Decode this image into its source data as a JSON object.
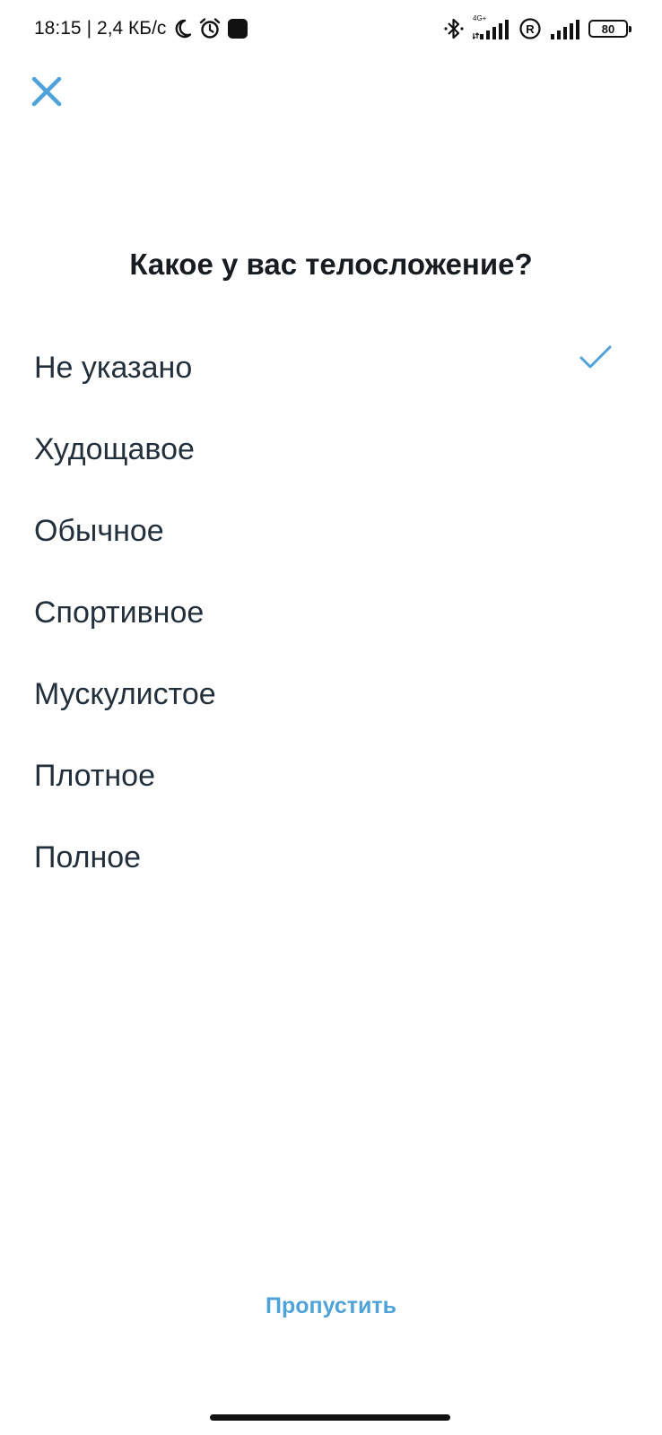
{
  "status_bar": {
    "time": "18:15",
    "separator": "|",
    "network_speed": "2,4 КБ/с",
    "network_type": "4G+",
    "battery": "80"
  },
  "screen": {
    "title": "Какое у вас телосложение?",
    "options": [
      {
        "label": "Не указано",
        "selected": true
      },
      {
        "label": "Худощавое",
        "selected": false
      },
      {
        "label": "Обычное",
        "selected": false
      },
      {
        "label": "Спортивное",
        "selected": false
      },
      {
        "label": "Мускулистое",
        "selected": false
      },
      {
        "label": "Плотное",
        "selected": false
      },
      {
        "label": "Полное",
        "selected": false
      }
    ],
    "skip_label": "Пропустить"
  },
  "colors": {
    "accent": "#4fa3d8",
    "text": "#23303b",
    "title": "#171c21",
    "background": "#ffffff"
  },
  "icons": {
    "close": "close-icon",
    "check": "check-icon"
  }
}
